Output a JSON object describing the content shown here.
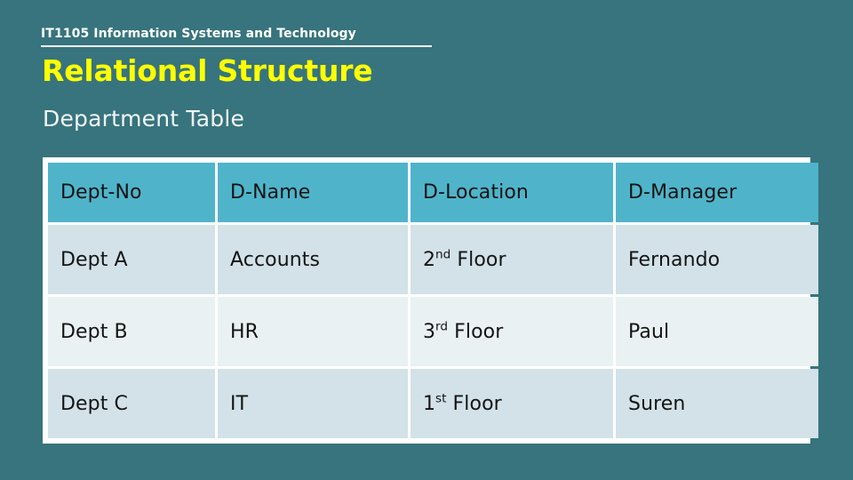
{
  "slide": {
    "course_title": "IT1105 Information Systems and Technology",
    "title": "Relational Structure",
    "subtitle": "Department Table",
    "background_color": "#37747D",
    "title_color": "#FFFF00",
    "header_row_color": "#4FB4CA",
    "row_dark_color": "#D2E2E8",
    "row_light_color": "#E9F1F3"
  },
  "table": {
    "columns": [
      {
        "label": "Dept-No"
      },
      {
        "label": "D-Name"
      },
      {
        "label": "D-Location"
      },
      {
        "label": "D-Manager"
      }
    ],
    "rows": [
      {
        "dept_no": "Dept A",
        "d_name": "Accounts",
        "d_location_number": "2",
        "d_location_ordinal": "nd",
        "d_location_suffix": " Floor",
        "d_manager": "Fernando"
      },
      {
        "dept_no": "Dept B",
        "d_name": "HR",
        "d_location_number": "3",
        "d_location_ordinal": "rd",
        "d_location_suffix": " Floor",
        "d_manager": "Paul"
      },
      {
        "dept_no": "Dept C",
        "d_name": "IT",
        "d_location_number": "1",
        "d_location_ordinal": "st",
        "d_location_suffix": " Floor",
        "d_manager": "Suren"
      }
    ]
  }
}
